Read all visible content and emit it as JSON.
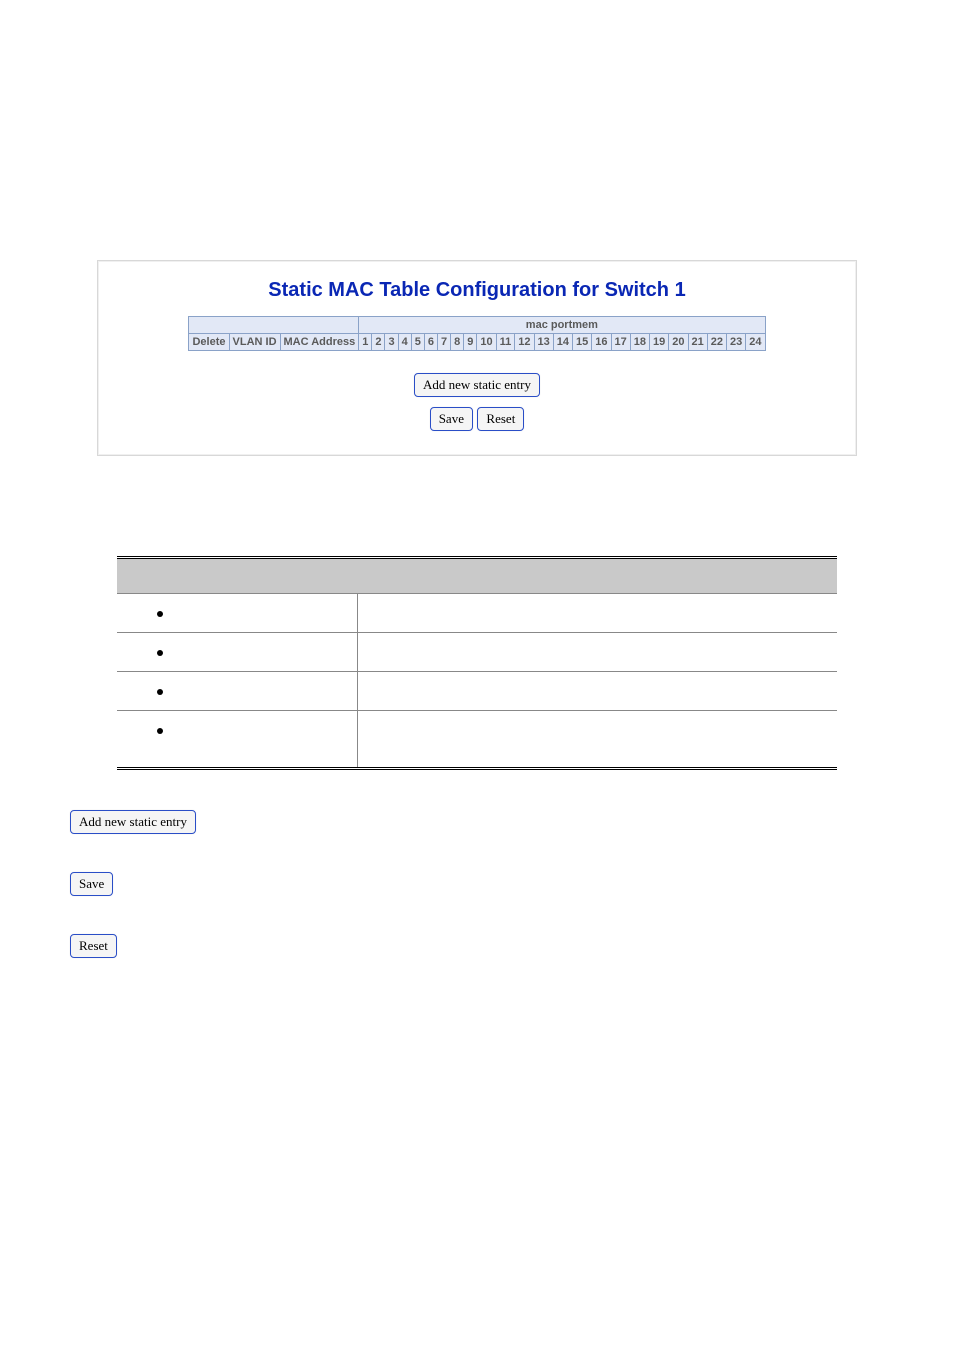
{
  "panel": {
    "title": "Static MAC Table Configuration for Switch 1",
    "header_group": "mac portmem",
    "columns": {
      "delete": "Delete",
      "vlan_id": "VLAN ID",
      "mac_address": "MAC Address",
      "ports": [
        "1",
        "2",
        "3",
        "4",
        "5",
        "6",
        "7",
        "8",
        "9",
        "10",
        "11",
        "12",
        "13",
        "14",
        "15",
        "16",
        "17",
        "18",
        "19",
        "20",
        "21",
        "22",
        "23",
        "24"
      ]
    },
    "buttons": {
      "add": "Add new static entry",
      "save": "Save",
      "reset": "Reset"
    }
  },
  "desc_table": {
    "rows": [
      {
        "bullet": true,
        "c1": "",
        "c2": ""
      },
      {
        "bullet": true,
        "c1": "",
        "c2": ""
      },
      {
        "bullet": true,
        "c1": "",
        "c2": ""
      },
      {
        "bullet": true,
        "c1": "",
        "c2": ""
      }
    ]
  },
  "standalone_buttons": {
    "add": "Add new static entry",
    "save": "Save",
    "reset": "Reset"
  }
}
